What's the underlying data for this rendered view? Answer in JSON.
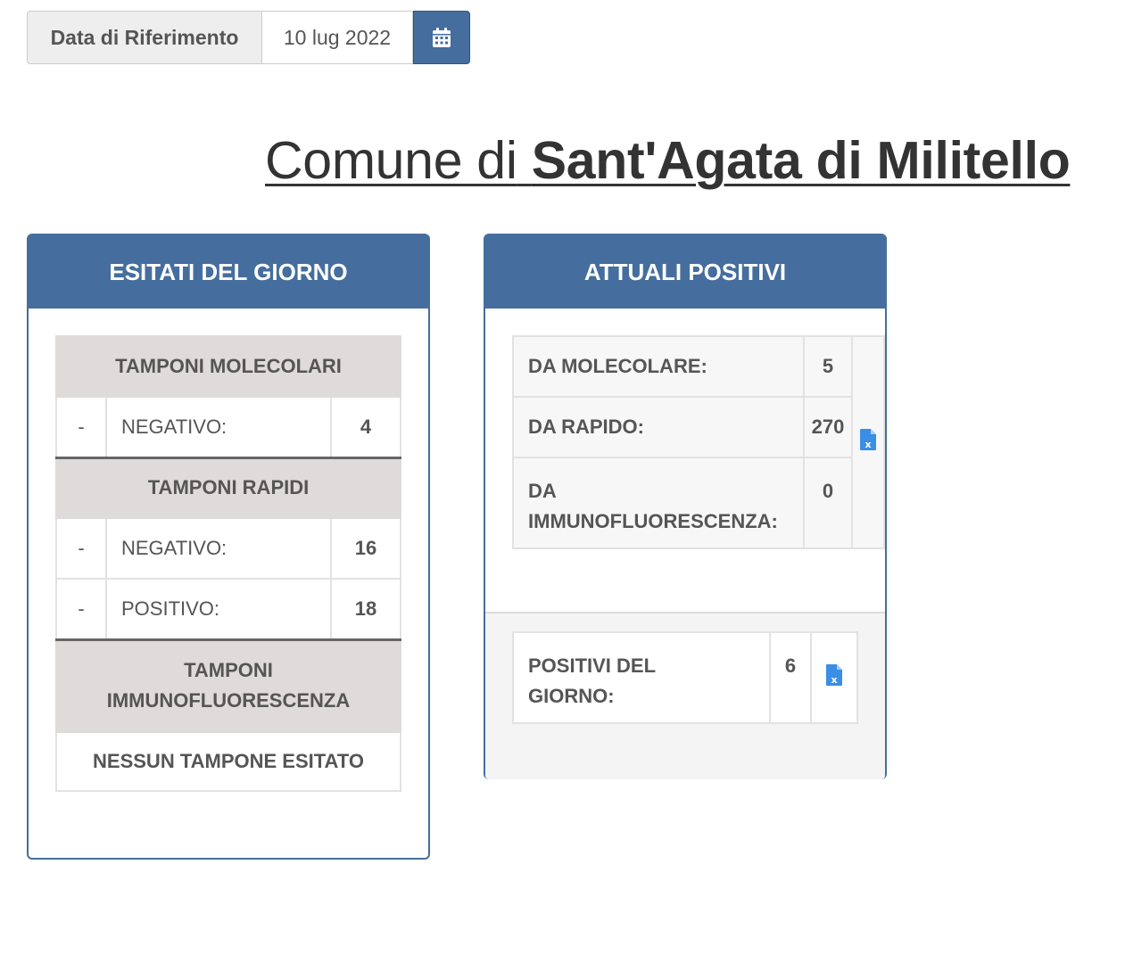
{
  "date_picker": {
    "label": "Data di Riferimento",
    "value": "10 lug 2022",
    "button_icon": "calendar-icon"
  },
  "title": {
    "prefix": "Comune di",
    "name": "Sant'Agata di Militello"
  },
  "esitati": {
    "header": "ESITATI DEL GIORNO",
    "molecolari": {
      "title": "TAMPONI MOLECOLARI",
      "rows": [
        {
          "dash": "-",
          "label": "NEGATIVO:",
          "value": "4"
        }
      ]
    },
    "rapidi": {
      "title": "TAMPONI RAPIDI",
      "rows": [
        {
          "dash": "-",
          "label": "NEGATIVO:",
          "value": "16"
        },
        {
          "dash": "-",
          "label": "POSITIVO:",
          "value": "18"
        }
      ]
    },
    "immuno": {
      "title_line1": "TAMPONI",
      "title_line2": "IMMUNOFLUORESCENZA",
      "empty": "NESSUN TAMPONE ESITATO"
    }
  },
  "attuali": {
    "header": "ATTUALI POSITIVI",
    "rows": [
      {
        "label": "DA MOLECOLARE:",
        "value": "5"
      },
      {
        "label": "DA RAPIDO:",
        "value": "270"
      },
      {
        "label_line1": "DA",
        "label_line2": "IMMUNOFLUORESCENZA:",
        "value": "0"
      }
    ],
    "export_icon": "excel-file-icon",
    "giorno": {
      "label_line1": "POSITIVI DEL",
      "label_line2": "GIORNO:",
      "value": "6"
    }
  },
  "colors": {
    "primary": "#456e9e",
    "section_bg": "#e0dbdb",
    "excel_icon": "#3a8ee6"
  }
}
